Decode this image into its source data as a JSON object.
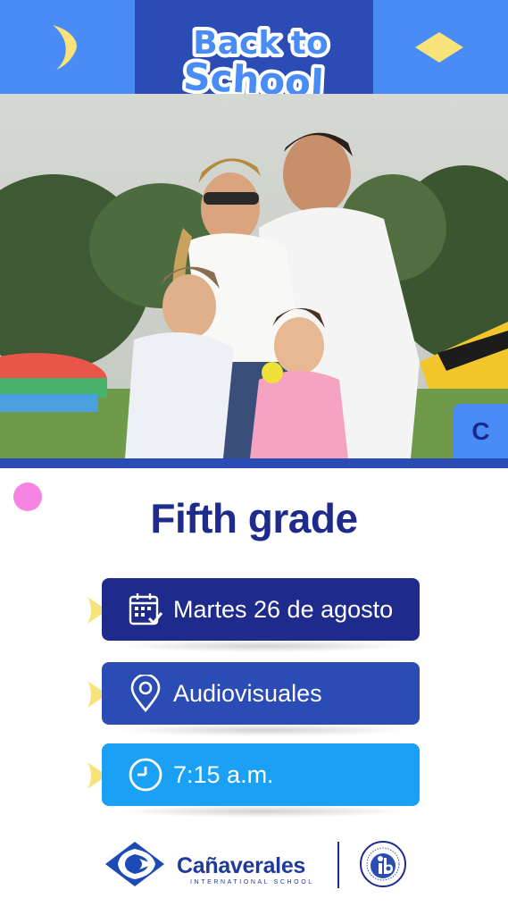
{
  "header": {
    "title_line1": "Back to",
    "title_line2": "School"
  },
  "photo": {
    "description_icon": "family-photo"
  },
  "grade": {
    "letter": "C",
    "title": "Fifth grade"
  },
  "details": {
    "date": "Martes 26 de agosto",
    "venue": "Audiovisuales",
    "time": "7:15 a.m."
  },
  "footer": {
    "brand_name": "Cañaverales",
    "brand_subtitle": "INTERNATIONAL SCHOOL",
    "partner_logo": "ib-world-school-logo"
  },
  "colors": {
    "primary_dark": "#1e2a8c",
    "primary": "#2b4bb5",
    "light_blue": "#4a8cf5",
    "sky": "#1aa0f5",
    "yellow": "#f8e37a",
    "pink": "#f584e3"
  }
}
